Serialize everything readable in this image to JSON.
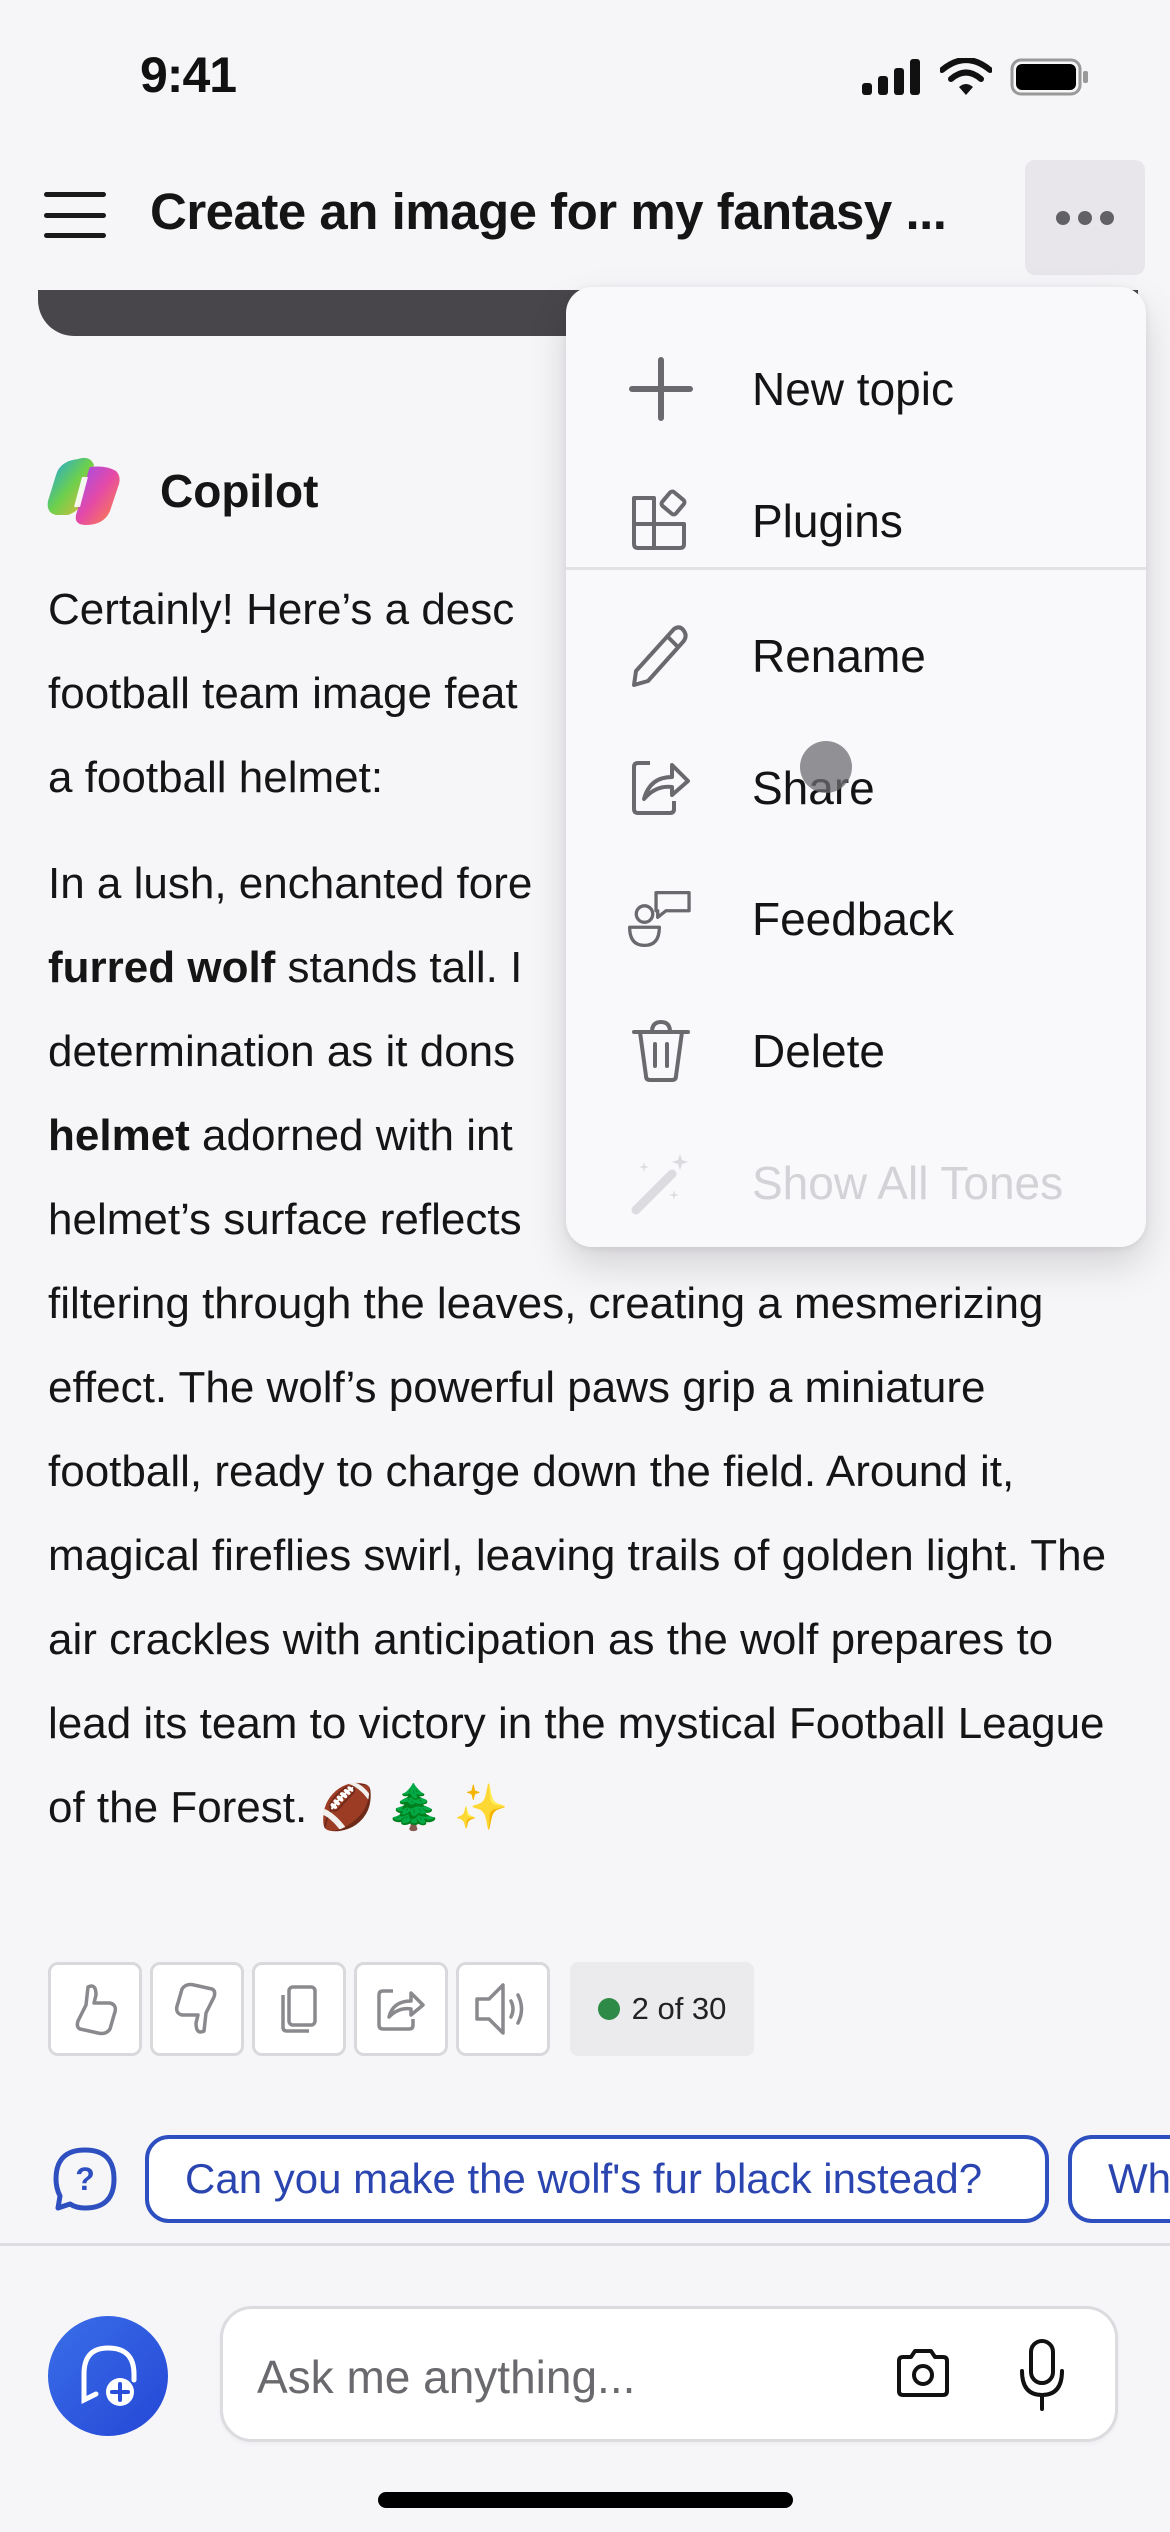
{
  "status_bar": {
    "time": "9:41",
    "icons": [
      "signal-icon",
      "wifi-icon",
      "battery-icon"
    ]
  },
  "header": {
    "title": "Create an image for my fantasy ...",
    "menu_icon": "hamburger-icon",
    "more_icon": "more-horizontal-icon"
  },
  "copilot": {
    "name": "Copilot",
    "message": {
      "intro": "Certainly! Here’s a desc… football team image feat… a football helmet:",
      "intro_lines": [
        "Certainly! Here’s a desc",
        "football team image feat",
        "a football helmet:"
      ],
      "body_segments": [
        {
          "text": "In a lush, enchanted fore",
          "bold": false
        },
        {
          "text": "furred wolf",
          "bold": true
        },
        {
          "text": " stands tall. I",
          "bold": false
        },
        {
          "text": "determination as it dons",
          "bold": false
        },
        {
          "text": "helmet",
          "bold": true
        },
        {
          "text": " adorned with int",
          "bold": false
        },
        {
          "text": "helmet’s surface reflects",
          "bold": false
        },
        {
          "text": "filtering through the leaves, creating a mesmerizing effect. The wolf’s powerful paws grip a miniature football, ready to charge down the field. Around it, magical fireflies swirl, leaving trails of golden light. The air crackles with anticipation as the wolf prepares to lead its team to victory in the mystical Football League of the Forest. 🏈 🌲 ✨",
          "bold": false
        }
      ]
    }
  },
  "actions": {
    "buttons": [
      {
        "name": "like-button",
        "icon": "thumbs-up-icon"
      },
      {
        "name": "dislike-button",
        "icon": "thumbs-down-icon"
      },
      {
        "name": "copy-button",
        "icon": "copy-icon"
      },
      {
        "name": "share-button",
        "icon": "share-icon"
      },
      {
        "name": "read-aloud-button",
        "icon": "speaker-icon"
      }
    ],
    "counter": "2 of 30",
    "counter_color": "#2e8b47"
  },
  "suggestions": {
    "icon": "question-bubble-icon",
    "chips": [
      "Can you make the wolf's fur black instead?",
      "Wh"
    ]
  },
  "composer": {
    "placeholder": "Ask me anything...",
    "new_chat_icon": "new-chat-icon",
    "camera_icon": "camera-icon",
    "mic_icon": "microphone-icon"
  },
  "dropdown": {
    "items": [
      {
        "label": "New topic",
        "icon": "plus-icon",
        "enabled": true
      },
      {
        "label": "Plugins",
        "icon": "plugins-icon",
        "enabled": true
      },
      {
        "label": "Rename",
        "icon": "pencil-icon",
        "enabled": true
      },
      {
        "label": "Share",
        "icon": "share-icon",
        "enabled": true
      },
      {
        "label": "Feedback",
        "icon": "feedback-icon",
        "enabled": true
      },
      {
        "label": "Delete",
        "icon": "trash-icon",
        "enabled": true
      },
      {
        "label": "Show All Tones",
        "icon": "magic-wand-icon",
        "enabled": false
      }
    ]
  },
  "colors": {
    "accent": "#2d4fbf",
    "background": "#f6f5f8",
    "new_chat": "#2f5de0"
  }
}
